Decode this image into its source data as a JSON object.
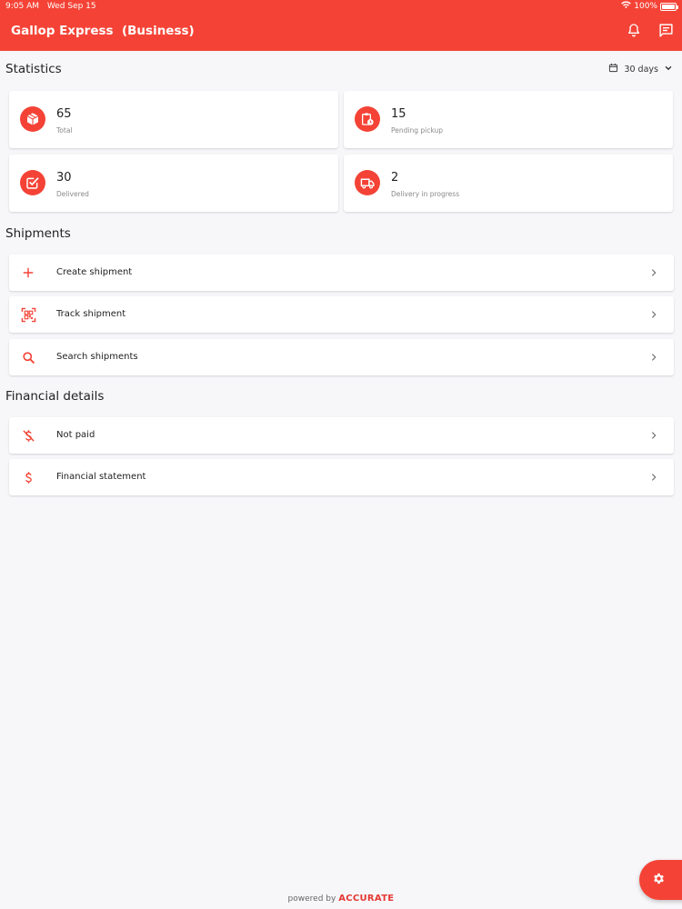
{
  "status_bar": {
    "time": "9:05 AM",
    "date": "Wed Sep 15",
    "battery": "100%",
    "battery_level": 1.0
  },
  "app_bar": {
    "title": "Gallop Express  (Business)",
    "icons": [
      "bell-icon",
      "chat-icon"
    ]
  },
  "statistics": {
    "title": "Statistics",
    "range_label": "30 days",
    "cards": [
      {
        "value": "65",
        "label": "Total",
        "icon": "box-icon"
      },
      {
        "value": "15",
        "label": "Pending pickup",
        "icon": "clipboard-clock-icon"
      },
      {
        "value": "30",
        "label": "Delivered",
        "icon": "checkbox-icon"
      },
      {
        "value": "2",
        "label": "Delivery in progress",
        "icon": "truck-icon"
      }
    ]
  },
  "shipments": {
    "title": "Shipments",
    "items": [
      {
        "label": "Create shipment",
        "icon": "plus-icon"
      },
      {
        "label": "Track shipment",
        "icon": "qr-scan-icon"
      },
      {
        "label": "Search shipments",
        "icon": "search-icon"
      }
    ]
  },
  "financial": {
    "title": "Financial details",
    "items": [
      {
        "label": "Not paid",
        "icon": "dollar-off-icon"
      },
      {
        "label": "Financial statement",
        "icon": "dollar-icon"
      }
    ]
  },
  "footer": {
    "powered_by": "powered by",
    "brand": "ACCURATE"
  },
  "colors": {
    "primary": "#f44336",
    "background": "#f7f6f9",
    "card": "#ffffff"
  }
}
